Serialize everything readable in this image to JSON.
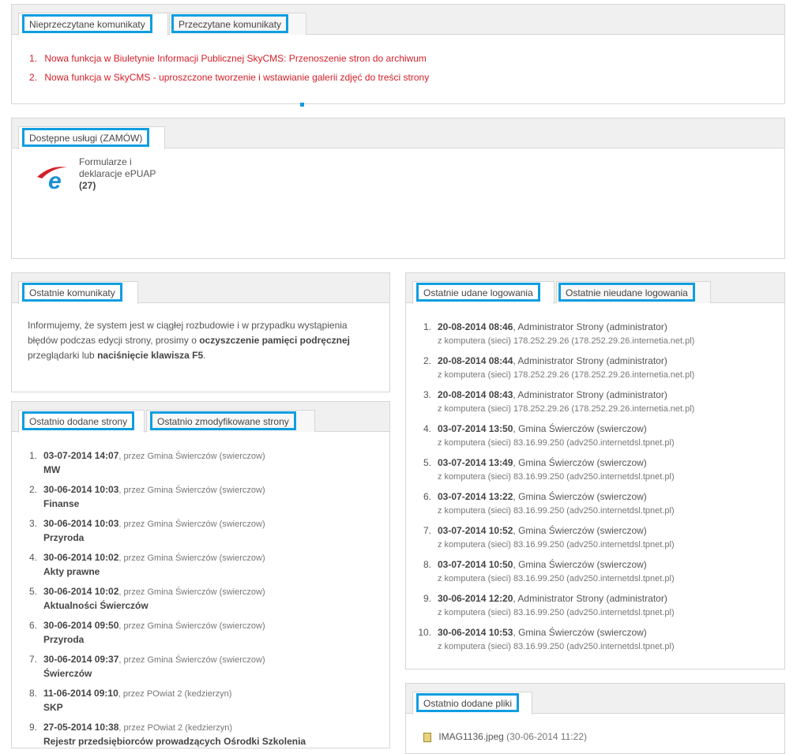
{
  "messages_panel": {
    "tabs": [
      "Nieprzeczytane komunikaty",
      "Przeczytane komunikaty"
    ],
    "items": [
      {
        "num": "1.",
        "text": "Nowa funkcja w Biuletynie Informacji Publicznej SkyCMS: Przenoszenie stron do archiwum"
      },
      {
        "num": "2.",
        "text": "Nowa funkcja w SkyCMS - uproszczone tworzenie i wstawianie galerii zdjęć do treści strony"
      }
    ]
  },
  "services_panel": {
    "tab": "Dostępne usługi (ZAMÓW)",
    "service": {
      "line1": "Formularze i",
      "line2": "deklaracje ePUAP",
      "count": "(27)"
    },
    "colors": {
      "logo_red": "#d4202a",
      "logo_blue": "#1a8fd6"
    }
  },
  "recent_messages": {
    "tab": "Ostatnie komunikaty",
    "text_1": "Informujemy, że system jest w ciągłej rozbudowie i w przypadku wystąpienia błędów podczas edycji strony, prosimy o ",
    "bold_1": "oczyszczenie pamięci podręcznej",
    "text_2": " przeglądarki lub ",
    "bold_2": "naciśnięcie klawisza F5",
    "text_3": "."
  },
  "recent_pages": {
    "tabs": [
      "Ostatnio dodane strony",
      "Ostatnio zmodyfikowane strony"
    ],
    "items": [
      {
        "num": "1.",
        "date": "03-07-2014 14:07",
        "by": ", przez Gmina Świerczów (swierczow)",
        "title": "MW"
      },
      {
        "num": "2.",
        "date": "30-06-2014 10:03",
        "by": ", przez Gmina Świerczów (swierczow)",
        "title": "Finanse"
      },
      {
        "num": "3.",
        "date": "30-06-2014 10:03",
        "by": ", przez Gmina Świerczów (swierczow)",
        "title": "Przyroda"
      },
      {
        "num": "4.",
        "date": "30-06-2014 10:02",
        "by": ", przez Gmina Świerczów (swierczow)",
        "title": "Akty prawne"
      },
      {
        "num": "5.",
        "date": "30-06-2014 10:02",
        "by": ", przez Gmina Świerczów (swierczow)",
        "title": "Aktualności Świerczów"
      },
      {
        "num": "6.",
        "date": "30-06-2014 09:50",
        "by": ", przez Gmina Świerczów (swierczow)",
        "title": "Przyroda"
      },
      {
        "num": "7.",
        "date": "30-06-2014 09:37",
        "by": ", przez Gmina Świerczów (swierczow)",
        "title": "Świerczów"
      },
      {
        "num": "8.",
        "date": "11-06-2014 09:10",
        "by": ", przez POwiat 2 (kedzierzyn)",
        "title": "SKP"
      },
      {
        "num": "9.",
        "date": "27-05-2014 10:38",
        "by": ", przez POwiat 2 (kedzierzyn)",
        "title": "Rejestr przedsiębiorców prowadzących Ośrodki Szkolenia"
      }
    ]
  },
  "logins": {
    "tabs": [
      "Ostatnie udane logowania",
      "Ostatnie nieudane logowania"
    ],
    "items": [
      {
        "num": "1.",
        "date": "20-08-2014 08:46",
        "user": ", Administrator Strony (administrator)",
        "sub": "z komputera (sieci) 178.252.29.26 (178.252.29.26.internetia.net.pl)"
      },
      {
        "num": "2.",
        "date": "20-08-2014 08:44",
        "user": ", Administrator Strony (administrator)",
        "sub": "z komputera (sieci) 178.252.29.26 (178.252.29.26.internetia.net.pl)"
      },
      {
        "num": "3.",
        "date": "20-08-2014 08:43",
        "user": ", Administrator Strony (administrator)",
        "sub": "z komputera (sieci) 178.252.29.26 (178.252.29.26.internetia.net.pl)"
      },
      {
        "num": "4.",
        "date": "03-07-2014 13:50",
        "user": ", Gmina Świerczów (swierczow)",
        "sub": "z komputera (sieci) 83.16.99.250 (adv250.internetdsl.tpnet.pl)"
      },
      {
        "num": "5.",
        "date": "03-07-2014 13:49",
        "user": ", Gmina Świerczów (swierczow)",
        "sub": "z komputera (sieci) 83.16.99.250 (adv250.internetdsl.tpnet.pl)"
      },
      {
        "num": "6.",
        "date": "03-07-2014 13:22",
        "user": ", Gmina Świerczów (swierczow)",
        "sub": "z komputera (sieci) 83.16.99.250 (adv250.internetdsl.tpnet.pl)"
      },
      {
        "num": "7.",
        "date": "03-07-2014 10:52",
        "user": ", Gmina Świerczów (swierczow)",
        "sub": "z komputera (sieci) 83.16.99.250 (adv250.internetdsl.tpnet.pl)"
      },
      {
        "num": "8.",
        "date": "03-07-2014 10:50",
        "user": ", Gmina Świerczów (swierczow)",
        "sub": "z komputera (sieci) 83.16.99.250 (adv250.internetdsl.tpnet.pl)"
      },
      {
        "num": "9.",
        "date": "30-06-2014 12:20",
        "user": ", Administrator Strony (administrator)",
        "sub": "z komputera (sieci) 83.16.99.250 (adv250.internetdsl.tpnet.pl)"
      },
      {
        "num": "10.",
        "date": "30-06-2014 10:53",
        "user": ", Gmina Świerczów (swierczow)",
        "sub": "z komputera (sieci) 83.16.99.250 (adv250.internetdsl.tpnet.pl)"
      }
    ]
  },
  "recent_files": {
    "tab": "Ostatnio dodane pliki",
    "items": [
      {
        "name": "IMAG1136.jpeg",
        "date": " (30-06-2014 11:22)"
      }
    ]
  },
  "theme": {
    "accent": "#0e9ee0",
    "message_red": "#d4202a"
  }
}
